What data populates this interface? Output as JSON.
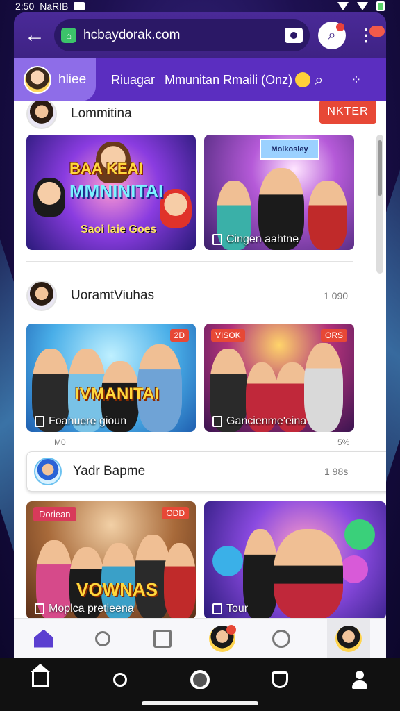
{
  "status_bar": {
    "time": "2:50",
    "carrier": "NaRIB"
  },
  "browser": {
    "url": "hcbaydorak.com"
  },
  "tabs": {
    "active_label": "hliee",
    "item_1": "Riuagar",
    "item_2": "Mmunitan Rmaili (Onz)"
  },
  "sections": [
    {
      "title": "Lommitina",
      "action": "NKTER"
    },
    {
      "title": "UoramtViuhas",
      "count": "1 090"
    },
    {
      "title": "Yadr Bapme",
      "count": "1 98s"
    }
  ],
  "cards": {
    "c1_big": "BAA   KEAI",
    "c1_title": "MMNINITAI",
    "c1_sub": "Saoi laie Goes",
    "c2_label": "Cingen aahtne",
    "c2_banner": "Molkosiey",
    "c3_badge": "2D",
    "c3_big": "IVMANITAI",
    "c3_label": "Foanuere gioun",
    "c4_badge1": "VISOK",
    "c4_badge2": "ORS",
    "c4_label": "Gancienme'eina",
    "c5_badge1": "Doriean",
    "c5_badge2": "ODD",
    "c5_big": "VOWNAS",
    "c5_label": "Moplca pretieena",
    "c6_label": "Tour"
  },
  "notes": {
    "left": "M0",
    "right": "5%"
  },
  "colors": {
    "brand": "#5b2ec0",
    "accent": "#e74836"
  }
}
